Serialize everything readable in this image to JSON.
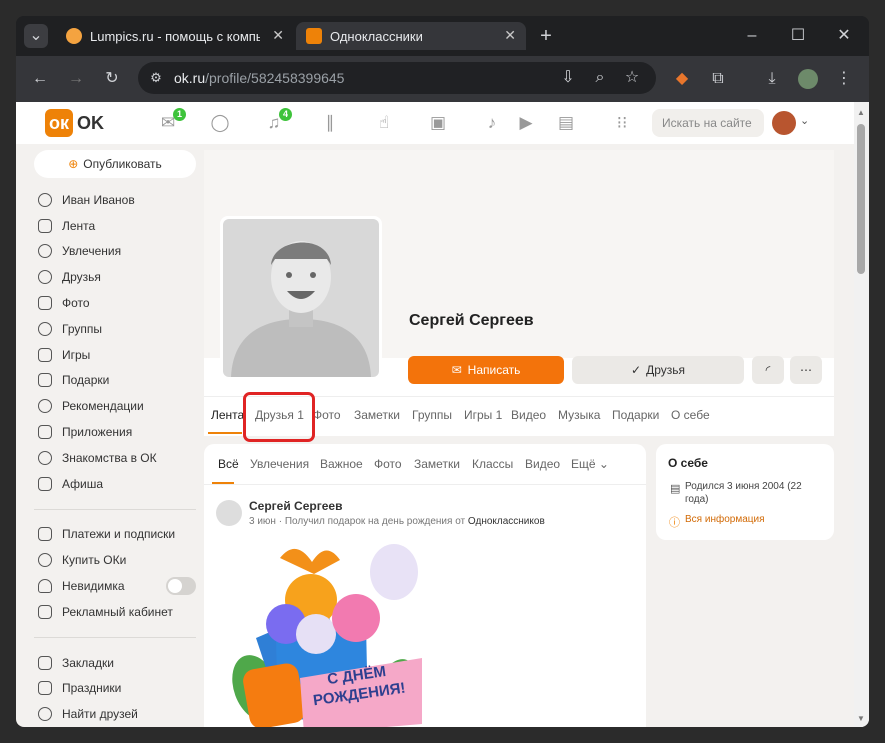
{
  "browser": {
    "tabs": [
      {
        "title": "Lumpics.ru - помощь с компьютером",
        "close": "✕"
      },
      {
        "title": "Одноклассники",
        "close": "✕"
      }
    ],
    "new_tab": "+",
    "url_host": "ok.ru",
    "url_path": "/profile/582458399645"
  },
  "ok": {
    "logo_text": "OK",
    "mail_badge": "1",
    "notif_badge": "4",
    "search_placeholder": "Искать на сайте",
    "publish_label": "Опубликовать",
    "menu": [
      "Иван Иванов",
      "Лента",
      "Увлечения",
      "Друзья",
      "Фото",
      "Группы",
      "Игры",
      "Подарки",
      "Рекомендации",
      "Приложения",
      "Знакомства в ОК",
      "Афиша"
    ],
    "menu2": [
      "Платежи и подписки",
      "Купить ОКи",
      "Невидимка",
      "Рекламный кабинет"
    ],
    "menu3": [
      "Закладки",
      "Праздники",
      "Найти друзей"
    ],
    "profile_name": "Сергей Сергеев",
    "write_label": "Написать",
    "friends_label": "Друзья",
    "nav_tabs": [
      "Лента",
      "Друзья 1",
      "Фото",
      "Заметки",
      "Группы",
      "Игры 1",
      "Видео",
      "Музыка",
      "Подарки",
      "О себе"
    ],
    "feed_tabs": [
      "Всё",
      "Увлечения",
      "Важное",
      "Фото",
      "Заметки",
      "Классы",
      "Видео",
      "Ещё"
    ],
    "post_author": "Сергей Сергеев",
    "post_meta": "3 июн · Получил подарок на день рождения от",
    "post_meta_link": "Одноклассников",
    "gift_text": "С ДНЁМ РОЖДЕНИЯ!",
    "about_title": "О себе",
    "about_born": "Родился 3 июня 2004 (22 года)",
    "about_all": "Вся информация"
  }
}
